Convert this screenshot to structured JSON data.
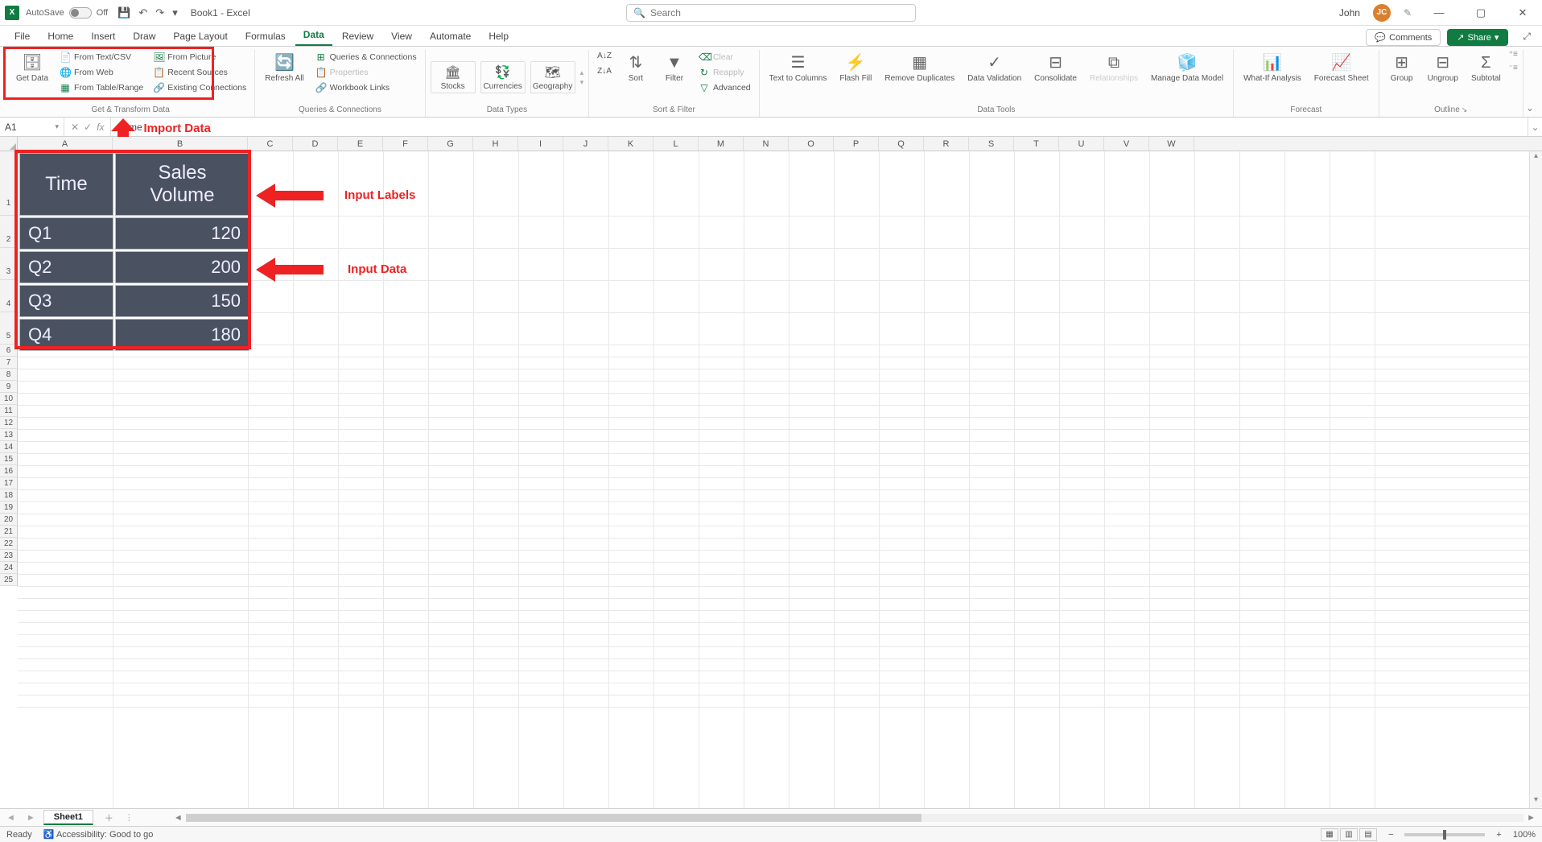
{
  "titleBar": {
    "autosave_label": "AutoSave",
    "autosave_state": "Off",
    "doc_title": "Book1 - Excel",
    "search_placeholder": "Search",
    "user_name": "John",
    "user_initials": "JC"
  },
  "tabs": {
    "items": [
      "File",
      "Home",
      "Insert",
      "Draw",
      "Page Layout",
      "Formulas",
      "Data",
      "Review",
      "View",
      "Automate",
      "Help"
    ],
    "active": "Data",
    "comments": "Comments",
    "share": "Share"
  },
  "ribbon": {
    "get_transform": {
      "label": "Get & Transform Data",
      "get_data": "Get Data",
      "from_text_csv": "From Text/CSV",
      "from_web": "From Web",
      "from_table_range": "From Table/Range",
      "from_picture": "From Picture",
      "recent_sources": "Recent Sources",
      "existing_conn": "Existing Connections"
    },
    "queries": {
      "label": "Queries & Connections",
      "refresh_all": "Refresh All",
      "queries_conn": "Queries & Connections",
      "properties": "Properties",
      "workbook_links": "Workbook Links"
    },
    "data_types": {
      "label": "Data Types",
      "stocks": "Stocks",
      "currencies": "Currencies",
      "geography": "Geography"
    },
    "sort_filter": {
      "label": "Sort & Filter",
      "sort": "Sort",
      "filter": "Filter",
      "clear": "Clear",
      "reapply": "Reapply",
      "advanced": "Advanced"
    },
    "data_tools": {
      "label": "Data Tools",
      "text_to_cols": "Text to Columns",
      "flash_fill": "Flash Fill",
      "remove_dup": "Remove Duplicates",
      "validation": "Data Validation",
      "consolidate": "Consolidate",
      "relationships": "Relationships",
      "manage_dm": "Manage Data Model"
    },
    "forecast": {
      "label": "Forecast",
      "what_if": "What-If Analysis",
      "forecast_sheet": "Forecast Sheet"
    },
    "outline": {
      "label": "Outline",
      "group": "Group",
      "ungroup": "Ungroup",
      "subtotal": "Subtotal"
    }
  },
  "formula_bar": {
    "namebox": "A1",
    "fx": "fx",
    "value": "Time"
  },
  "annotations": {
    "import_data": "Import Data",
    "input_labels": "Input Labels",
    "input_data": "Input Data"
  },
  "columns": [
    "A",
    "B",
    "C",
    "D",
    "E",
    "F",
    "G",
    "H",
    "I",
    "J",
    "K",
    "L",
    "M",
    "N",
    "O",
    "P",
    "Q",
    "R",
    "S",
    "T",
    "U",
    "V",
    "W"
  ],
  "table": {
    "headers": {
      "col1": "Time",
      "col2": "Sales Volume"
    },
    "rows": [
      {
        "c1": "Q1",
        "c2": "120"
      },
      {
        "c1": "Q2",
        "c2": "200"
      },
      {
        "c1": "Q3",
        "c2": "150"
      },
      {
        "c1": "Q4",
        "c2": "180"
      }
    ]
  },
  "sheet_tabs": {
    "sheet1": "Sheet1"
  },
  "status_bar": {
    "ready": "Ready",
    "accessibility": "Accessibility: Good to go",
    "zoom": "100%"
  }
}
